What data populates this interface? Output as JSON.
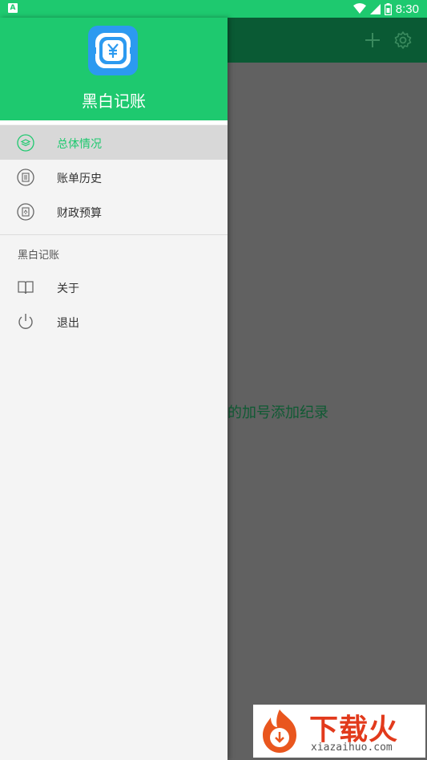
{
  "status_bar": {
    "notification_icon": "A",
    "icons": [
      "wifi-icon",
      "signal-icon",
      "battery-icon"
    ],
    "time": "8:30"
  },
  "app_toolbar": {
    "icons": [
      "plus-icon",
      "gear-icon"
    ]
  },
  "content": {
    "empty_hint": "的加号添加纪录"
  },
  "drawer": {
    "app_name": "黑白记账",
    "menu": [
      {
        "label": "总体情况",
        "icon": "layers-icon",
        "active": true
      },
      {
        "label": "账单历史",
        "icon": "clipboard-icon",
        "active": false
      },
      {
        "label": "财政预算",
        "icon": "budget-icon",
        "active": false
      }
    ],
    "section_title": "黑白记账",
    "menu2": [
      {
        "label": "关于",
        "icon": "book-icon"
      },
      {
        "label": "退出",
        "icon": "power-icon"
      }
    ]
  },
  "watermark": {
    "title": "下载火",
    "url": "xiazaihuo.com"
  },
  "colors": {
    "accent": "#1ec96f",
    "toolbar": "#0a5a34",
    "scrim": "#616161"
  }
}
